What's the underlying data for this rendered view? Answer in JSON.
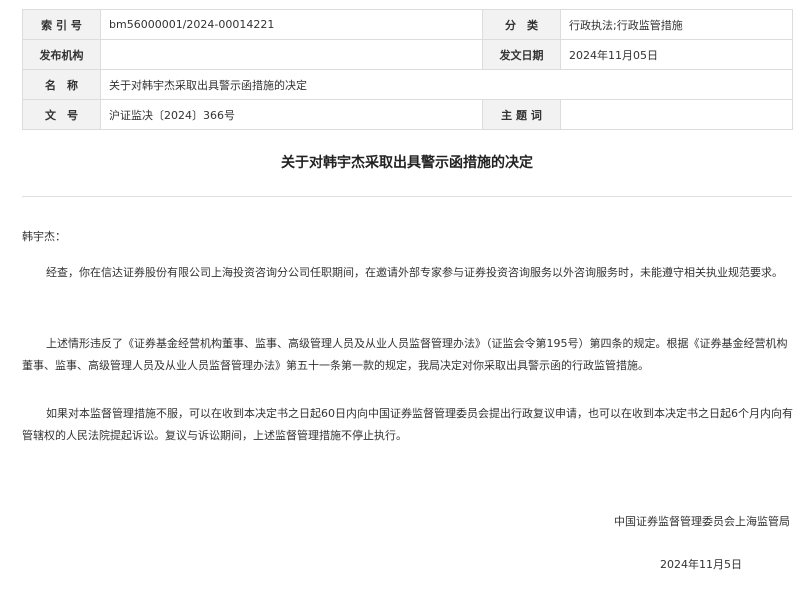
{
  "meta": {
    "index_label": "索 引 号",
    "index_value": "bm56000001/2024-00014221",
    "category_label": "分　类",
    "category_value": "行政执法;行政监管措施",
    "issuer_label": "发布机构",
    "issuer_value": "",
    "date_label": "发文日期",
    "date_value": "2024年11月05日",
    "name_label": "名　称",
    "name_value": "关于对韩宇杰采取出具警示函措施的决定",
    "docno_label": "文　号",
    "docno_value": "沪证监决〔2024〕366号",
    "subject_label": "主 题 词",
    "subject_value": ""
  },
  "document": {
    "title": "关于对韩宇杰采取出具警示函措施的决定",
    "addressee": "韩宇杰：",
    "paragraphs": [
      "经查，你在信达证券股份有限公司上海投资咨询分公司任职期间，在邀请外部专家参与证券投资咨询服务以外咨询服务时，未能遵守相关执业规范要求。",
      "上述情形违反了《证券基金经营机构董事、监事、高级管理人员及从业人员监督管理办法》（证监会令第195号）第四条的规定。根据《证券基金经营机构董事、监事、高级管理人员及从业人员监督管理办法》第五十一条第一款的规定，我局决定对你采取出具警示函的行政监管措施。",
      "如果对本监督管理措施不服，可以在收到本决定书之日起60日内向中国证券监督管理委员会提出行政复议申请，也可以在收到本决定书之日起6个月内向有管辖权的人民法院提起诉讼。复议与诉讼期间，上述监督管理措施不停止执行。"
    ],
    "issuer": "中国证券监督管理委员会上海监管局",
    "date": "2024年11月5日"
  }
}
